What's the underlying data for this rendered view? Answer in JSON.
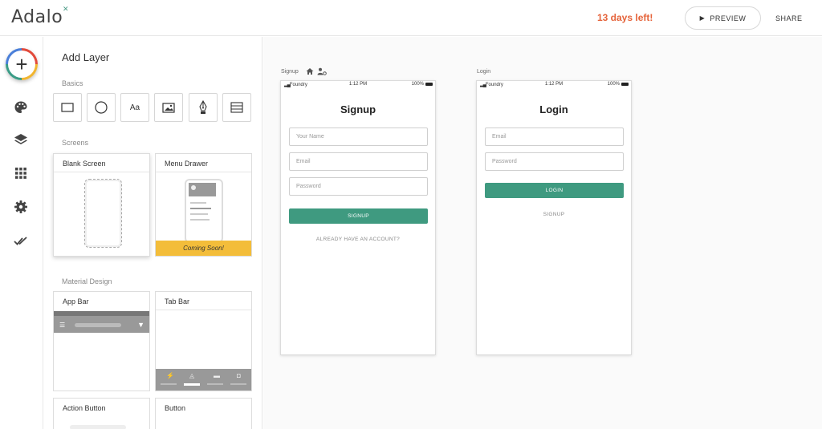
{
  "app": {
    "logo": "Adalo",
    "trial": "13 days left!",
    "preview": "PREVIEW",
    "share": "SHARE"
  },
  "leftnav": {
    "icons": [
      "add-icon",
      "palette-icon",
      "layers-icon",
      "grid-icon",
      "gear-icon",
      "checkmark-icon"
    ]
  },
  "panel": {
    "title": "Add Layer",
    "basics_label": "Basics",
    "basic_text_glyph": "Aa",
    "basics": [
      "rectangle-icon",
      "ellipse-icon",
      "text-icon",
      "image-icon",
      "pen-icon",
      "list-icon"
    ],
    "screens_label": "Screens",
    "screens": [
      {
        "label": "Blank Screen"
      },
      {
        "label": "Menu Drawer",
        "badge": "Coming Soon!"
      }
    ],
    "material_label": "Material Design",
    "material": [
      {
        "label": "App Bar"
      },
      {
        "label": "Tab Bar"
      },
      {
        "label": "Action Button"
      },
      {
        "label": "Button"
      }
    ]
  },
  "canvas": {
    "screens": [
      {
        "name": "Signup",
        "status": {
          "carrier": "Foundry",
          "time": "1:12 PM",
          "battery": "100%"
        },
        "title": "Signup",
        "fields": [
          "Your Name",
          "Email",
          "Password"
        ],
        "button": "SIGNUP",
        "link": "ALREADY HAVE AN ACCOUNT?"
      },
      {
        "name": "Login",
        "status": {
          "carrier": "Foundry",
          "time": "1:12 PM",
          "battery": "100%"
        },
        "title": "Login",
        "fields": [
          "Email",
          "Password"
        ],
        "button": "LOGIN",
        "link": "SIGNUP"
      }
    ]
  },
  "colors": {
    "accent": "#3f9a80",
    "trial": "#e5633a",
    "coming_soon": "#f3bd3a"
  }
}
